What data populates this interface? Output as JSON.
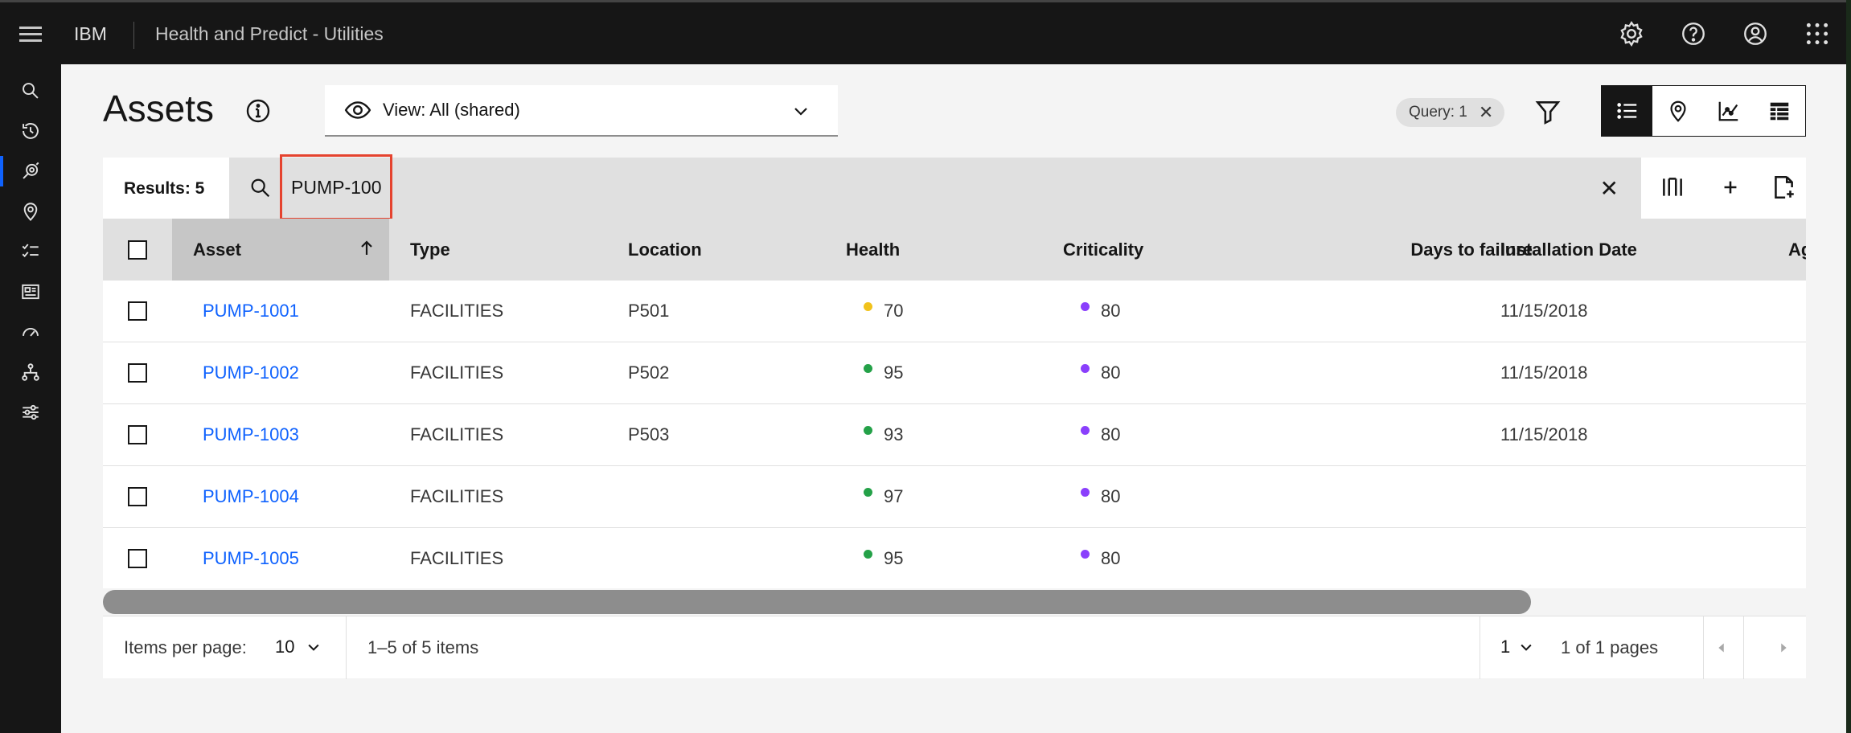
{
  "header": {
    "brand": "IBM",
    "app_title": "Health and Predict - Utilities"
  },
  "icons": {
    "topbar": [
      "menu-icon",
      "settings-icon",
      "help-icon",
      "user-avatar-icon",
      "app-switcher-icon"
    ],
    "sidebar": [
      "search-icon",
      "recent-history-icon",
      "assets-icon",
      "location-icon",
      "checklist-icon",
      "dashboard-card-icon",
      "gauge-icon",
      "hierarchy-icon",
      "settings-sliders-icon"
    ]
  },
  "page": {
    "title": "Assets",
    "view_label": "View: All (shared)",
    "query_tag": "Query: 1",
    "query_tag_close": "✕"
  },
  "toolbar": {
    "results_label": "Results: 5",
    "search_value": "PUMP-100",
    "clear_symbol": "✕"
  },
  "table": {
    "columns": [
      "Asset",
      "Type",
      "Location",
      "Health",
      "Criticality",
      "Days to failure",
      "Installation Date",
      "Ag"
    ],
    "rows": [
      {
        "asset": "PUMP-1001",
        "type": "FACILITIES",
        "location": "P501",
        "health": "70",
        "health_color": "#f1c21b",
        "criticality": "80",
        "criticality_color": "#8a3ffc",
        "days_to_failure": "",
        "installation_date": "11/15/2018"
      },
      {
        "asset": "PUMP-1002",
        "type": "FACILITIES",
        "location": "P502",
        "health": "95",
        "health_color": "#24a148",
        "criticality": "80",
        "criticality_color": "#8a3ffc",
        "days_to_failure": "",
        "installation_date": "11/15/2018"
      },
      {
        "asset": "PUMP-1003",
        "type": "FACILITIES",
        "location": "P503",
        "health": "93",
        "health_color": "#24a148",
        "criticality": "80",
        "criticality_color": "#8a3ffc",
        "days_to_failure": "",
        "installation_date": "11/15/2018"
      },
      {
        "asset": "PUMP-1004",
        "type": "FACILITIES",
        "location": "",
        "health": "97",
        "health_color": "#24a148",
        "criticality": "80",
        "criticality_color": "#8a3ffc",
        "days_to_failure": "",
        "installation_date": ""
      },
      {
        "asset": "PUMP-1005",
        "type": "FACILITIES",
        "location": "",
        "health": "95",
        "health_color": "#24a148",
        "criticality": "80",
        "criticality_color": "#8a3ffc",
        "days_to_failure": "",
        "installation_date": ""
      }
    ]
  },
  "pagination": {
    "items_per_page_label": "Items per page:",
    "items_per_page_value": "10",
    "range_text": "1–5 of 5 items",
    "page_value": "1",
    "pages_text": "1 of 1 pages"
  },
  "colors": {
    "accent": "#0f62fe",
    "highlight_box": "#e5432f",
    "topbar": "#161616"
  }
}
